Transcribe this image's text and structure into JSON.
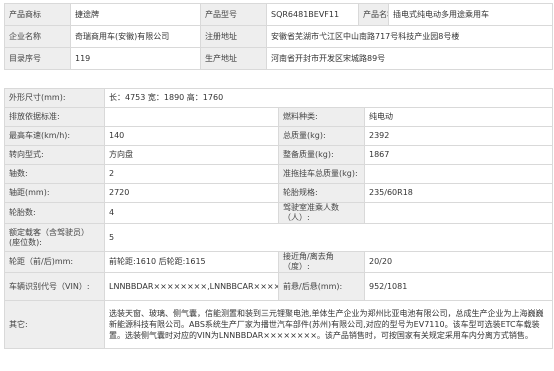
{
  "header": {
    "rows": [
      [
        {
          "label": "产品商标",
          "value": "捷途牌"
        },
        {
          "label": "产品型号",
          "value": "SQR6481BEVF11"
        },
        {
          "label": "产品名称",
          "value": "插电式纯电动多用途乘用车"
        }
      ],
      [
        {
          "label": "企业名称",
          "value": "奇瑞商用车(安徽)有限公司"
        },
        {
          "label": "注册地址",
          "value": "安徽省芜湖市弋江区中山南路717号科技产业园8号楼"
        }
      ],
      [
        {
          "label": "目录序号",
          "value": "119"
        },
        {
          "label": "生产地址",
          "value": "河南省开封市开发区宋城路89号"
        }
      ]
    ]
  },
  "specs": {
    "dimensions": {
      "label": "外形尺寸(mm):",
      "value": "长：4753 宽：1890 高：1760"
    },
    "emission": {
      "label": "排放依据标准:",
      "value": ""
    },
    "fuel": {
      "label": "燃料种类:",
      "value": "纯电动"
    },
    "top_speed": {
      "label": "最高车速(km/h):",
      "value": "140"
    },
    "total_mass": {
      "label": "总质量(kg):",
      "value": "2392"
    },
    "steering": {
      "label": "转向型式:",
      "value": "方向盘"
    },
    "curb_mass": {
      "label": "整备质量(kg):",
      "value": "1867"
    },
    "axles": {
      "label": "轴数:",
      "value": "2"
    },
    "trailer_mass": {
      "label": "准拖挂车总质量(kg):",
      "value": ""
    },
    "wheelbase": {
      "label": "轴距(mm):",
      "value": "2720"
    },
    "tire": {
      "label": "轮胎规格:",
      "value": "235/60R18"
    },
    "tire_count": {
      "label": "轮胎数:",
      "value": "4"
    },
    "cab_passengers": {
      "label": "驾驶室准乘人数（人）:",
      "value": ""
    },
    "seats": {
      "label": "额定载客（含驾驶员）(座位数):",
      "value": "5"
    },
    "track": {
      "label": "轮距（前/后)mm:",
      "value": "前轮距:1610 后轮距:1615"
    },
    "angles": {
      "label": "接近角/离去角（度）:",
      "value": "20/20"
    },
    "vin": {
      "label": "车辆识别代号（VIN）:",
      "value": "LNNBBDAR××××××××,LNNBBCAR××××××××"
    },
    "overhang": {
      "label": "前悬/后悬(mm):",
      "value": "952/1081"
    },
    "other": {
      "label": "其它:",
      "value": "选装天窗、玻璃、侧气囊，信能测置和装到三元锂聚电池,单体生产企业为郑州比亚电池有限公司，总成生产企业为上海巍巍新能源科技有限公司。ABS系统生产厂家为播世汽车部件(苏州)有限公司,对应的型号为EV7110。该车型可选装ETC车载装置。选装侧气囊时对应的VIN为LNNBBDAR××××××××。该产品销售时，可按国家有关规定采用车内分离方式销售。"
    }
  }
}
